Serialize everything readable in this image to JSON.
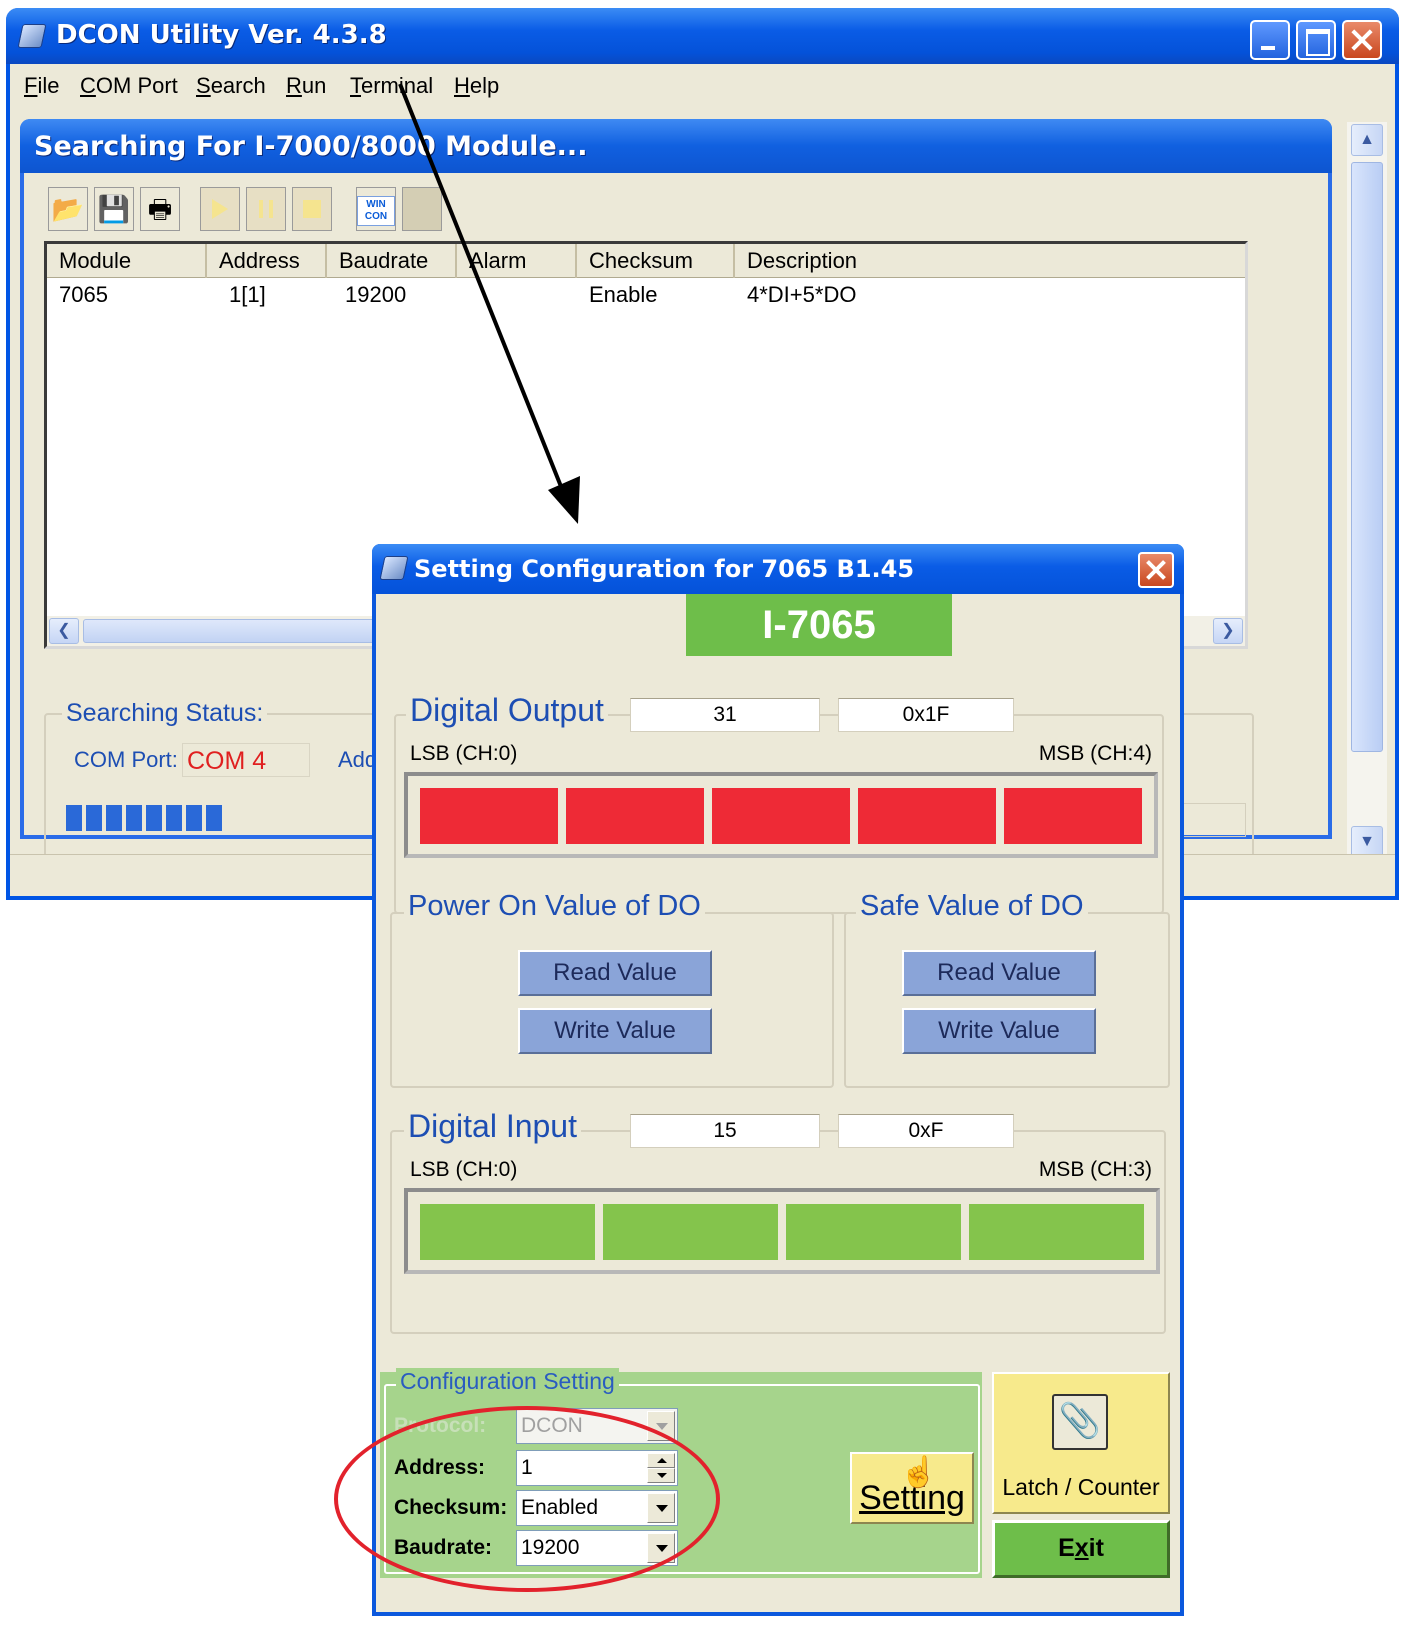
{
  "main_window": {
    "title": "DCON Utility Ver.  4.3.8",
    "menu": [
      "File",
      "COM Port",
      "Search",
      "Run",
      "Terminal",
      "Help"
    ]
  },
  "child_window": {
    "title": "Searching For I-7000/8000 Module...",
    "toolbar": {
      "buttons": [
        "open-folder-icon",
        "save-icon",
        "print-icon",
        "play-icon",
        "pause-icon",
        "stop-icon",
        "wincon-icon",
        "blank-icon"
      ],
      "wincon_label": "WIN CON"
    },
    "list": {
      "columns": [
        "Module",
        "Address",
        "Baudrate",
        "Alarm",
        "Checksum",
        "Description"
      ],
      "rows": [
        {
          "module": "7065",
          "address": "1[1]",
          "baudrate": "19200",
          "alarm": "",
          "checksum": "Enable",
          "description": "4*DI+5*DO"
        }
      ]
    },
    "status": {
      "legend": "Searching Status:",
      "com_label": "COM Port:",
      "com_value": "COM 4",
      "addr_label": "Add"
    }
  },
  "dialog": {
    "title": "Setting Configuration for 7065 B1.45",
    "model": "I-7065",
    "digital_output": {
      "legend": "Digital Output",
      "decimal": "31",
      "hex": "0x1F",
      "lsb_label": "LSB (CH:0)",
      "msb_label": "MSB (CH:4)",
      "bits": [
        1,
        1,
        1,
        1,
        1
      ],
      "on_color": "#ee2a36"
    },
    "power_on": {
      "legend": "Power On Value of DO",
      "read_label": "Read Value",
      "write_label": "Write Value"
    },
    "safe_value": {
      "legend": "Safe Value of DO",
      "read_label": "Read Value",
      "write_label": "Write Value"
    },
    "digital_input": {
      "legend": "Digital Input",
      "decimal": "15",
      "hex": "0xF",
      "lsb_label": "LSB (CH:0)",
      "msb_label": "MSB (CH:3)",
      "bits": [
        1,
        1,
        1,
        1
      ],
      "on_color": "#84c44c"
    },
    "config": {
      "legend": "Configuration Setting",
      "protocol_label": "Protocol:",
      "protocol_value": "DCON",
      "address_label": "Address:",
      "address_value": "1",
      "checksum_label": "Checksum:",
      "checksum_value": "Enabled",
      "baudrate_label": "Baudrate:",
      "baudrate_value": "19200"
    },
    "setting_button": "Setting",
    "latch_button": "Latch / Counter",
    "exit_button_pre": "E",
    "exit_button_ul": "x",
    "exit_button_post": "it"
  }
}
